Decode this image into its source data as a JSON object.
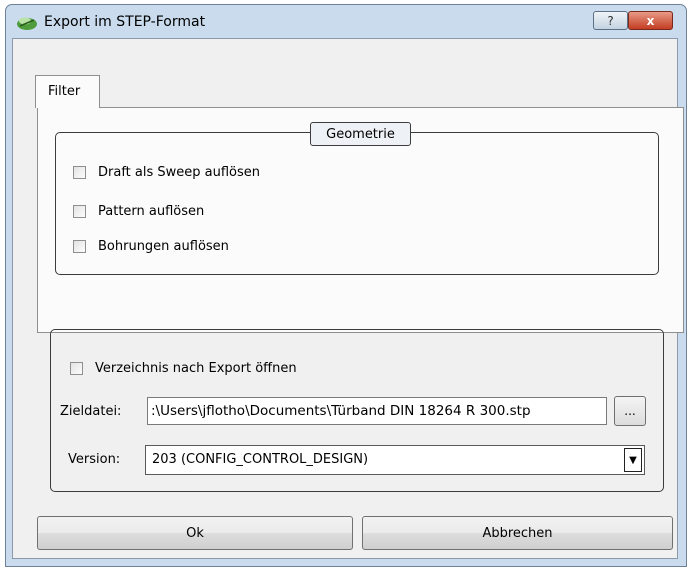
{
  "window": {
    "title": "Export im STEP-Format",
    "help_label": "?",
    "close_label": "x"
  },
  "tabs": [
    {
      "label": "Filter"
    }
  ],
  "geometry_group": {
    "title": "Geometrie",
    "options": [
      {
        "label": "Draft als Sweep auflösen",
        "checked": false
      },
      {
        "label": "Pattern auflösen",
        "checked": false
      },
      {
        "label": "Bohrungen auflösen",
        "checked": false
      }
    ]
  },
  "output": {
    "open_folder_label": "Verzeichnis nach Export öffnen",
    "open_folder_checked": false,
    "target_label": "Zieldatei:",
    "target_value": ":\\Users\\jflotho\\Documents\\Türband DIN 18264 R 300.stp",
    "browse_label": "...",
    "version_label": "Version:",
    "version_value": "203 (CONFIG_CONTROL_DESIGN)"
  },
  "buttons": {
    "ok": "Ok",
    "cancel": "Abbrechen"
  },
  "colors": {
    "frame": "#c9dbec",
    "close": "#c43d23"
  }
}
